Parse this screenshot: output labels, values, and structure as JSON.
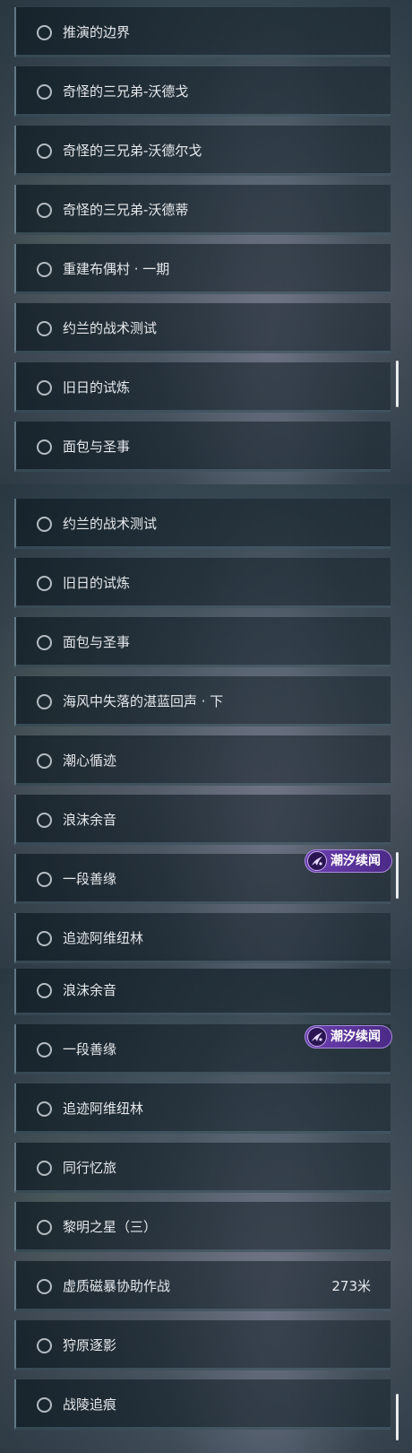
{
  "panels": [
    {
      "items": [
        {
          "label": "推演的边界"
        },
        {
          "label": "奇怪的三兄弟-沃德戈"
        },
        {
          "label": "奇怪的三兄弟-沃德尔戈"
        },
        {
          "label": "奇怪的三兄弟-沃德蒂"
        },
        {
          "label": "重建布偶村 · 一期"
        },
        {
          "label": "约兰的战术测试"
        },
        {
          "label": "旧日的试炼"
        },
        {
          "label": "面包与圣事"
        }
      ]
    },
    {
      "items": [
        {
          "label": "约兰的战术测试"
        },
        {
          "label": "旧日的试炼"
        },
        {
          "label": "面包与圣事"
        },
        {
          "label": "海风中失落的湛蓝回声 · 下"
        },
        {
          "label": "潮心循迹"
        },
        {
          "label": "浪沫余音"
        },
        {
          "label": "一段善缘"
        },
        {
          "label": "追迹阿维纽林"
        }
      ],
      "badge": {
        "label": "潮汐续闻",
        "icon": "tidal-tale-icon"
      }
    },
    {
      "items": [
        {
          "label": "浪沫余音"
        },
        {
          "label": "一段善缘"
        },
        {
          "label": "追迹阿维纽林"
        },
        {
          "label": "同行忆旅"
        },
        {
          "label": "黎明之星（三）"
        },
        {
          "label": "虚质磁暴协助作战",
          "distance": "273米"
        },
        {
          "label": "狩原逐影"
        },
        {
          "label": "战陵追痕"
        }
      ],
      "badge": {
        "label": "潮汐续闻",
        "icon": "tidal-tale-icon"
      }
    }
  ],
  "colors": {
    "text": "#e6e9ec",
    "radio": "#b4bcc2",
    "badge_bg": "#6b3fb0",
    "scroll_thumb": "#e8ecee"
  }
}
